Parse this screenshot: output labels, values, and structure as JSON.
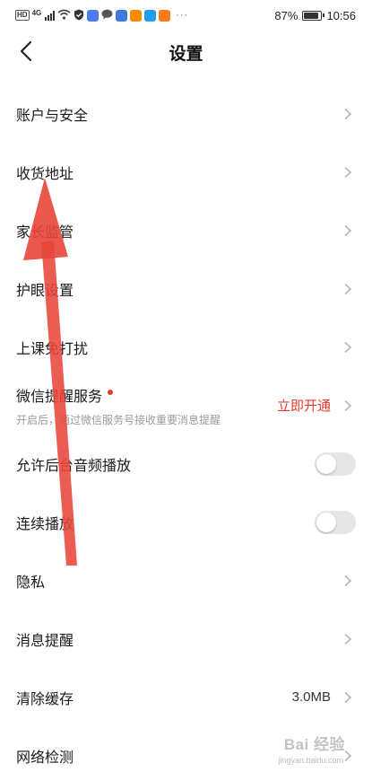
{
  "status_bar": {
    "hd": "HD",
    "net": "4G",
    "dots": "···",
    "battery_percent": "87%",
    "battery_level": 0.87,
    "time": "10:56",
    "app_icon_colors": [
      "#4a7cf0",
      "#555555",
      "#3e7be0",
      "#ff8a00",
      "#1e9ef0",
      "#ff7a1a"
    ]
  },
  "header": {
    "title": "设置",
    "back_icon": "chevron-left-icon"
  },
  "rows": [
    {
      "label": "账户与安全"
    },
    {
      "label": "收货地址"
    },
    {
      "label": "家长监管"
    },
    {
      "label": "护眼设置"
    },
    {
      "label": "上课免打扰"
    },
    {
      "label": "微信提醒服务",
      "sub": "开启后，通过微信服务号接收重要消息提醒",
      "action": "立即开通"
    },
    {
      "label": "允许后台音频播放",
      "toggle": false
    },
    {
      "label": "连续播放",
      "toggle": false
    },
    {
      "label": "隐私"
    },
    {
      "label": "消息提醒"
    },
    {
      "label": "清除缓存",
      "value": "3.0MB"
    },
    {
      "label": "网络检测"
    }
  ],
  "watermark": {
    "text": "Bai 经验",
    "sub": "jingyan.baidu.com"
  },
  "colors": {
    "accent_red": "#e8392b",
    "arrow_red": "#e8453a",
    "toggle_off": "#e6e6e6",
    "chevron": "#b8b8b8"
  }
}
